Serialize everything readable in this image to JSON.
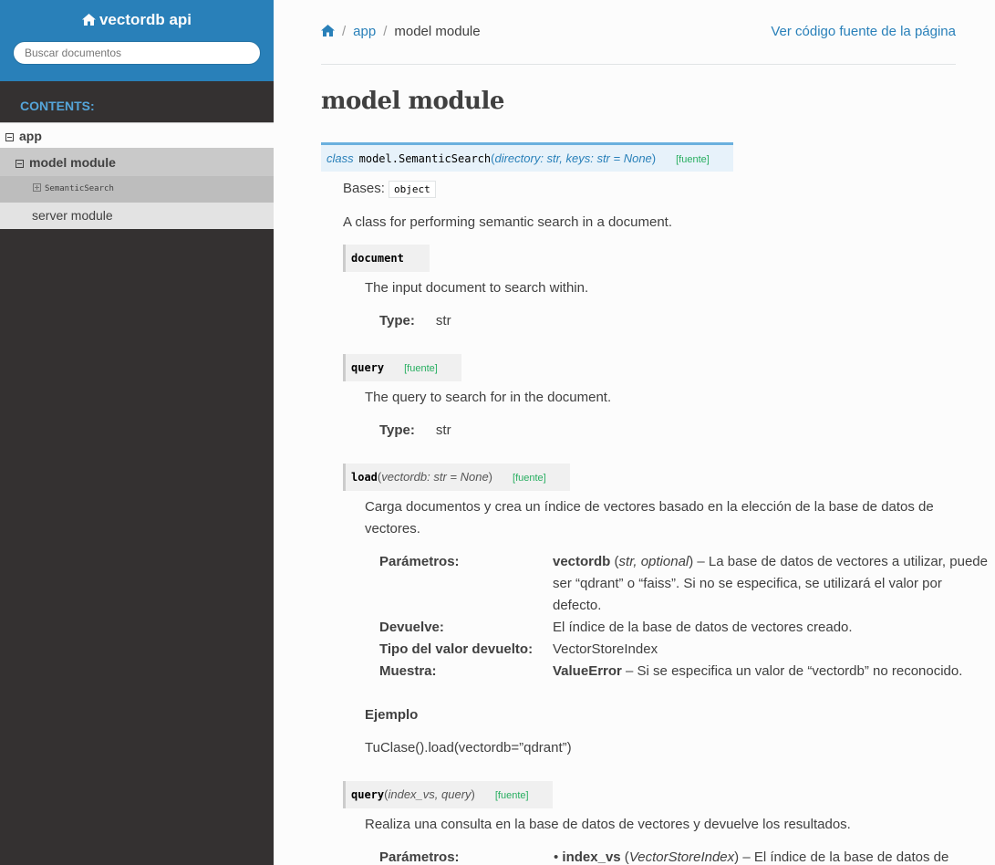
{
  "sidebar": {
    "project_title": "vectordb api",
    "search_placeholder": "Buscar documentos",
    "caption": "CONTENTS:",
    "nav": {
      "app": "app",
      "model_module": "model module",
      "semantic_search": "SemanticSearch",
      "server_module": "server module"
    }
  },
  "breadcrumb": {
    "module": "app",
    "current": "model module",
    "view_source": "Ver código fuente de la página"
  },
  "page_title": "model module",
  "class_sig": {
    "keyword": "class",
    "name": "model.SemanticSearch",
    "open": "(",
    "params": "directory: str, keys: str = None",
    "close": ")",
    "source": "[fuente]"
  },
  "bases_label": "Bases:",
  "bases_value": "object",
  "class_desc": "A class for performing semantic search in a document.",
  "attr_document": {
    "name": "document",
    "desc": "The input document to search within.",
    "type_label": "Type:",
    "type_value": "str"
  },
  "attr_query": {
    "name": "query",
    "source": "[fuente]",
    "desc": "The query to search for in the document.",
    "type_label": "Type:",
    "type_value": "str"
  },
  "method_load": {
    "name": "load",
    "open": "(",
    "params": "vectordb: str = None",
    "close": ")",
    "source": "[fuente]",
    "desc_line1": "Carga documentos y crea un índice de vectores basado en la elección de la base de datos de",
    "desc_line2": "vectores.",
    "params_label": "Parámetros:",
    "param_name": "vectordb",
    "param_open": " (",
    "param_type": "str, optional",
    "param_rest": ") – La base de datos de vectores a utilizar, puede ser “qdrant” o “faiss”. Si no se especifica, se utilizará el valor por defecto.",
    "returns_label": "Devuelve:",
    "returns_value": "El índice de la base de datos de vectores creado.",
    "rtype_label": "Tipo del valor devuelto:",
    "rtype_value": "VectorStoreIndex",
    "raises_label": "Muestra:",
    "raises_name": "ValueError",
    "raises_value": " – Si se especifica un valor de “vectordb” no reconocido.",
    "example_heading": "Ejemplo",
    "example_code": "TuClase().load(vectordb=”qdrant”)"
  },
  "method_query": {
    "name": "query",
    "open": "(",
    "params": "index_vs, query",
    "close": ")",
    "source": "[fuente]",
    "desc": "Realiza una consulta en la base de datos de vectores y devuelve los resultados.",
    "params_label": "Parámetros:",
    "param_name": "index_vs",
    "param_open": " (",
    "param_type": "VectorStoreIndex",
    "param_rest": ") – El índice de la base de datos de"
  }
}
